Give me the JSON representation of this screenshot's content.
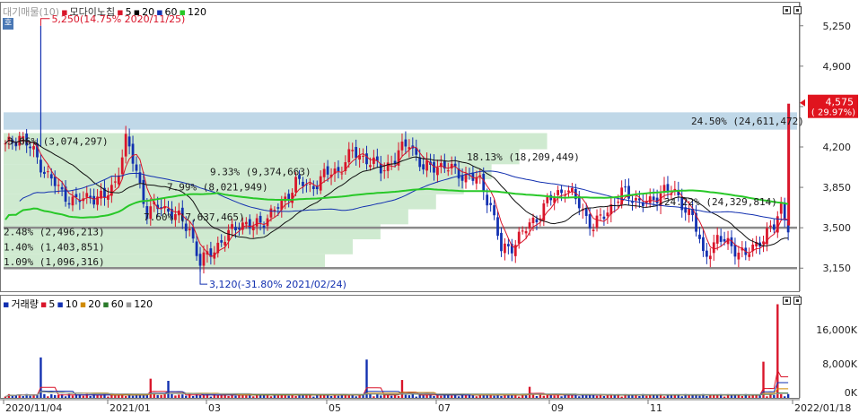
{
  "colors": {
    "up": "#d9152a",
    "down": "#1230b0",
    "ma5": "#d9152a",
    "ma20": "#111111",
    "ma60": "#1230b0",
    "ma120": "#28c828",
    "bandBlue": "#b9d4e6",
    "bandGreen": "#bfe3c0",
    "supportLine": "#8a8a8a",
    "priceTagBg": "#e0141e",
    "vol20": "#d08a00",
    "vol60": "#2a7a2a",
    "vol120": "#999999"
  },
  "price_panel": {
    "legend": {
      "title": "대기매물(10)",
      "candle": "모다이노칩",
      "ma5": "5",
      "ma20": "20",
      "ma60": "60",
      "ma120": "120"
    },
    "left_tab": "호",
    "high_annotation": "5,250(14.75% 2020/11/25)",
    "low_annotation": "3,120(-31.80% 2021/02/24)",
    "current_price": "4,575",
    "current_change": "( 29.97%)",
    "y_ticks": [
      "5,250",
      "4,900",
      "4,550",
      "4,200",
      "3,850",
      "3,500",
      "3,150"
    ]
  },
  "volume_panel": {
    "legend": {
      "title": "거래량",
      "ma5": "5",
      "ma10": "10",
      "ma20": "20",
      "ma60": "60",
      "ma120": "120"
    },
    "y_ticks": [
      "16,000K",
      "8,000K",
      "0K"
    ]
  },
  "x_axis": {
    "labels": [
      "2020/11/04",
      "2021/01",
      "03",
      "05",
      "07",
      "09",
      "11",
      "2022/01/18"
    ]
  },
  "chart_data": {
    "type": "candlestick",
    "title": "모다이노칩",
    "price_axis": {
      "ylim": [
        2950,
        5450
      ],
      "ticks": [
        5250,
        4900,
        4550,
        4200,
        3850,
        3500,
        3150
      ]
    },
    "x_range": [
      "2020/11/04",
      "2022/01/18"
    ],
    "high": {
      "price": 5250,
      "change_pct": 14.75,
      "date": "2020/11/25"
    },
    "low": {
      "price": 3120,
      "change_pct": -31.8,
      "date": "2021/02/24"
    },
    "current": {
      "price": 4575,
      "change_pct": 29.97
    },
    "support_lines": [
      3500,
      3150
    ],
    "supply_bands": [
      {
        "label": "24.50% (24,611,472)",
        "top": 4500,
        "bottom": 4350,
        "highlight": true
      },
      {
        "label": "3.06% (3,074,297)",
        "top": 4320,
        "bottom": 4180
      },
      {
        "label": "18.13% (18,209,449)",
        "top": 4180,
        "bottom": 4050
      },
      {
        "label": "9.33% (9,374,663)",
        "top": 4050,
        "bottom": 3920
      },
      {
        "label": "7.99% (8,021,949)",
        "top": 3920,
        "bottom": 3790
      },
      {
        "label": "24.22% (24,329,814)",
        "top": 3790,
        "bottom": 3660
      },
      {
        "label": "7.60% (7,637,465)",
        "top": 3660,
        "bottom": 3530
      },
      {
        "label": "2.48% (2,496,213)",
        "top": 3530,
        "bottom": 3400
      },
      {
        "label": "1.40% (1,403,851)",
        "top": 3400,
        "bottom": 3270
      },
      {
        "label": "1.09% (1,096,316)",
        "top": 3270,
        "bottom": 3140
      }
    ],
    "close_path": [
      [
        0,
        4200
      ],
      [
        4,
        4300
      ],
      [
        8,
        4150
      ],
      [
        12,
        3950
      ],
      [
        16,
        3800
      ],
      [
        20,
        3720
      ],
      [
        24,
        3780
      ],
      [
        28,
        3750
      ],
      [
        31,
        3900
      ],
      [
        34,
        4250
      ],
      [
        37,
        4000
      ],
      [
        40,
        3620
      ],
      [
        44,
        3700
      ],
      [
        48,
        3600
      ],
      [
        52,
        3500
      ],
      [
        55,
        3180
      ],
      [
        58,
        3300
      ],
      [
        62,
        3400
      ],
      [
        66,
        3550
      ],
      [
        70,
        3500
      ],
      [
        74,
        3600
      ],
      [
        78,
        3700
      ],
      [
        82,
        3900
      ],
      [
        86,
        3850
      ],
      [
        90,
        3950
      ],
      [
        94,
        4000
      ],
      [
        98,
        4150
      ],
      [
        102,
        4100
      ],
      [
        106,
        4000
      ],
      [
        110,
        4100
      ],
      [
        114,
        4250
      ],
      [
        118,
        4000
      ],
      [
        122,
        4050
      ],
      [
        126,
        4000
      ],
      [
        130,
        3950
      ],
      [
        134,
        3900
      ],
      [
        137,
        3700
      ],
      [
        140,
        3300
      ],
      [
        143,
        3350
      ],
      [
        146,
        3450
      ],
      [
        150,
        3600
      ],
      [
        154,
        3750
      ],
      [
        158,
        3850
      ],
      [
        162,
        3700
      ],
      [
        166,
        3500
      ],
      [
        170,
        3650
      ],
      [
        174,
        3800
      ],
      [
        178,
        3750
      ],
      [
        182,
        3700
      ],
      [
        186,
        3850
      ],
      [
        190,
        3750
      ],
      [
        194,
        3600
      ],
      [
        197,
        3250
      ],
      [
        201,
        3400
      ],
      [
        205,
        3350
      ],
      [
        209,
        3250
      ],
      [
        213,
        3400
      ],
      [
        217,
        3500
      ],
      [
        219,
        3700
      ],
      [
        221,
        3520
      ]
    ],
    "volume": {
      "ylim": [
        0,
        24000
      ],
      "unit": "K",
      "ticks": [
        16000,
        8000,
        0
      ],
      "spikes": [
        [
          10,
          9500
        ],
        [
          41,
          4500
        ],
        [
          46,
          4000
        ],
        [
          102,
          9000
        ],
        [
          112,
          4200
        ],
        [
          148,
          2600
        ],
        [
          214,
          8500
        ],
        [
          218,
          22000
        ]
      ]
    }
  }
}
